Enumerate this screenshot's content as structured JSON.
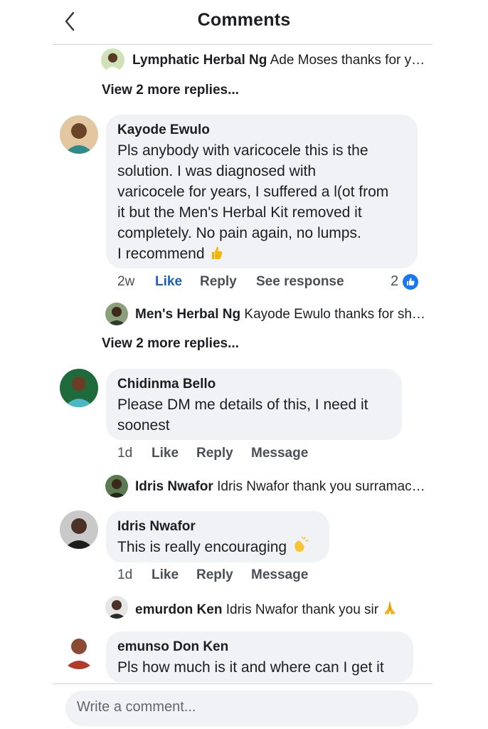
{
  "header": {
    "title": "Comments"
  },
  "thread1": {
    "reply": {
      "name": "Lymphatic Herbal Ng",
      "text": "Ade Moses thanks for yo..."
    },
    "more_replies": "View 2 more replies..."
  },
  "comment1": {
    "name": "Kayode Ewulo",
    "lines": [
      "Pls anybody with varicocele this is the",
      "solution. I was diagnosed with",
      "varicocele for years, I suffered a l(ot from",
      "it but the Men's Herbal Kit removed it",
      "completely. No pain again, no lumps.",
      "I recommend"
    ],
    "time": "2w",
    "like": "Like",
    "reply": "Reply",
    "extra": "See response",
    "reaction_count": "2",
    "reply_preview": {
      "name": "Men's Herbal Ng",
      "text": "Kayode Ewulo thanks for sha..."
    },
    "more_replies": "View 2 more replies..."
  },
  "comment2": {
    "name": "Chidinma Bello",
    "lines": [
      "Please DM me details of this, I need it",
      "soonest"
    ],
    "time": "1d",
    "like": "Like",
    "reply": "Reply",
    "extra": "Message",
    "reply_preview": {
      "name": "Idris Nwafor",
      "text": "Idris Nwafor thank you surramacia..."
    }
  },
  "comment3": {
    "name": "Idris Nwafor",
    "lines": [
      "This is really encouraging"
    ],
    "time": "1d",
    "like": "Like",
    "reply": "Reply",
    "extra": "Message",
    "reply_preview": {
      "name": "emurdon Ken",
      "text": "Idris Nwafor thank you sir"
    }
  },
  "comment4": {
    "name": "emunso Don Ken",
    "lines": [
      "Pls how much is it and where can I get it"
    ]
  },
  "composer": {
    "placeholder": "Write a comment..."
  },
  "colors": {
    "link_blue": "#1b5fbd",
    "bubble_bg": "#f0f2f5",
    "like_badge": "#1877f2"
  }
}
